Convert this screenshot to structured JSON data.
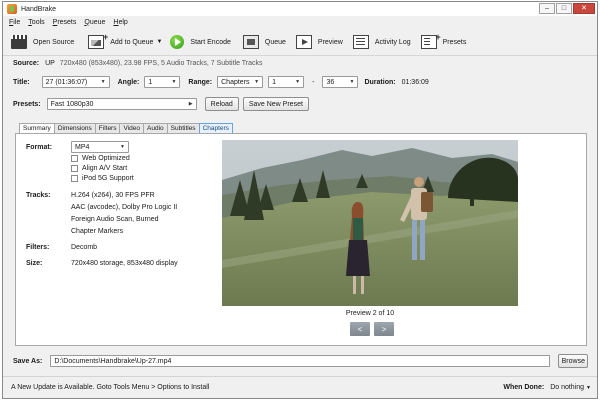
{
  "window": {
    "title": "HandBrake"
  },
  "menu": [
    "File",
    "Tools",
    "Presets",
    "Queue",
    "Help"
  ],
  "toolbar": {
    "open_source": "Open Source",
    "add_to_queue": "Add to Queue",
    "start_encode": "Start Encode",
    "queue": "Queue",
    "preview": "Preview",
    "activity_log": "Activity Log",
    "presets": "Presets"
  },
  "source": {
    "label": "Source:",
    "name": "UP",
    "details": "720x480 (853x480), 23.98 FPS, 5 Audio Tracks, 7 Subtitle Tracks"
  },
  "title_row": {
    "title_label": "Title:",
    "title_value": "27 (01:36:07)",
    "angle_label": "Angle:",
    "angle_value": "1",
    "range_label": "Range:",
    "range_type": "Chapters",
    "range_start": "1",
    "range_sep": "-",
    "range_end": "36",
    "duration_label": "Duration:",
    "duration_value": "01:36:09"
  },
  "presets_row": {
    "label": "Presets:",
    "value": "Fast 1080p30",
    "reload": "Reload",
    "save_new": "Save New Preset"
  },
  "tabs": [
    "Summary",
    "Dimensions",
    "Filters",
    "Video",
    "Audio",
    "Subtitles",
    "Chapters"
  ],
  "summary": {
    "format_label": "Format:",
    "format_value": "MP4",
    "checks": [
      "Web Optimized",
      "Align A/V Start",
      "iPod 5G Support"
    ],
    "tracks_label": "Tracks:",
    "tracks": [
      "H.264 (x264), 30 FPS PFR",
      "AAC (avcodec), Dolby Pro Logic II",
      "Foreign Audio Scan, Burned",
      "Chapter Markers"
    ],
    "filters_label": "Filters:",
    "filters_value": "Decomb",
    "size_label": "Size:",
    "size_value": "720x480 storage, 853x480 display"
  },
  "preview": {
    "caption": "Preview 2 of 10",
    "prev": "<",
    "next": ">"
  },
  "save": {
    "label": "Save As:",
    "path": "D:\\Documents\\Handbrake\\Up-27.mp4",
    "browse": "Browse"
  },
  "status": {
    "update_msg": "A New Update is Available. Goto Tools Menu > Options to Install",
    "when_done_label": "When Done:",
    "when_done_value": "Do nothing"
  }
}
